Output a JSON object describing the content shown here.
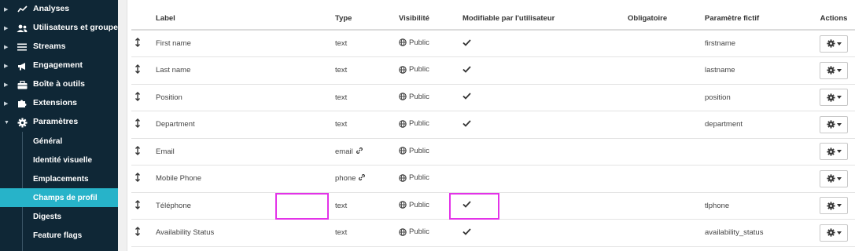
{
  "sidebar": {
    "items": [
      {
        "label": "Analyses",
        "icon": "chart-line-icon"
      },
      {
        "label": "Utilisateurs et groupes",
        "icon": "users-icon"
      },
      {
        "label": "Streams",
        "icon": "menu-lines-icon"
      },
      {
        "label": "Engagement",
        "icon": "megaphone-icon"
      },
      {
        "label": "Boîte à outils",
        "icon": "toolbox-icon"
      },
      {
        "label": "Extensions",
        "icon": "puzzle-icon"
      },
      {
        "label": "Paramètres",
        "icon": "gear-icon"
      }
    ],
    "sub_items": [
      {
        "label": "Général"
      },
      {
        "label": "Identité visuelle"
      },
      {
        "label": "Emplacements"
      },
      {
        "label": "Champs de profil",
        "active": true
      },
      {
        "label": "Digests"
      },
      {
        "label": "Feature flags"
      }
    ]
  },
  "table": {
    "headers": {
      "label": "Label",
      "type": "Type",
      "visibility": "Visibilité",
      "editable": "Modifiable par l'utilisateur",
      "required": "Obligatoire",
      "param": "Paramètre fictif",
      "actions": "Actions"
    },
    "rows": [
      {
        "label": "First name",
        "type": "text",
        "link": false,
        "visibility": "Public",
        "editable": true,
        "required": false,
        "param": "firstname"
      },
      {
        "label": "Last name",
        "type": "text",
        "link": false,
        "visibility": "Public",
        "editable": true,
        "required": false,
        "param": "lastname"
      },
      {
        "label": "Position",
        "type": "text",
        "link": false,
        "visibility": "Public",
        "editable": true,
        "required": false,
        "param": "position"
      },
      {
        "label": "Department",
        "type": "text",
        "link": false,
        "visibility": "Public",
        "editable": true,
        "required": false,
        "param": "department"
      },
      {
        "label": "Email",
        "type": "email",
        "link": true,
        "visibility": "Public",
        "editable": false,
        "required": false,
        "param": ""
      },
      {
        "label": "Mobile Phone",
        "type": "phone",
        "link": true,
        "visibility": "Public",
        "editable": false,
        "required": false,
        "param": ""
      },
      {
        "label": "Téléphone",
        "type": "text",
        "link": false,
        "visibility": "Public",
        "editable": true,
        "required": false,
        "param": "tlphone"
      },
      {
        "label": "Availability Status",
        "type": "text",
        "link": false,
        "visibility": "Public",
        "editable": true,
        "required": false,
        "param": "availability_status"
      }
    ]
  },
  "colors": {
    "sidebar_bg": "#0f2736",
    "active_item": "#27b3c9",
    "highlight": "#e333e8"
  }
}
